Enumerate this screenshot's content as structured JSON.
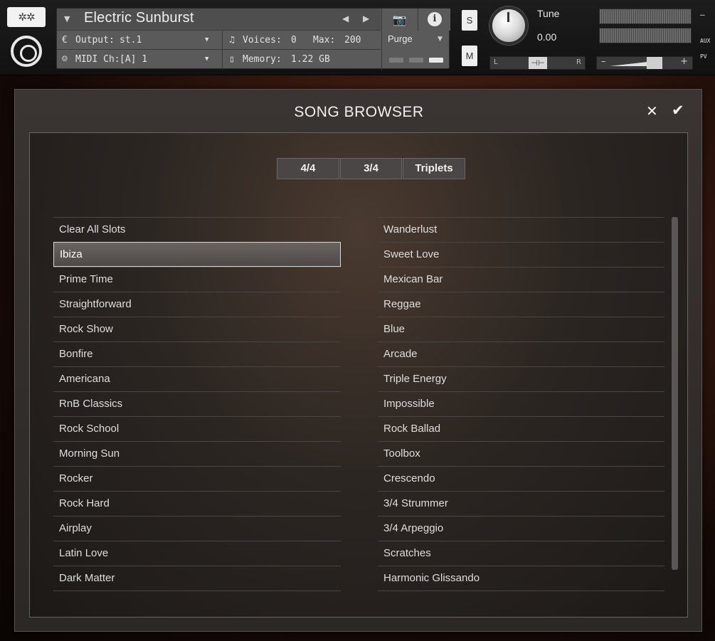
{
  "header": {
    "logo_icon": "snowflake-icon",
    "instrument_name": "Electric Sunburst",
    "output_label": "Output:",
    "output_value": "st.1",
    "voices_label": "Voices:",
    "voices_value": "0",
    "max_label": "Max:",
    "max_value": "200",
    "purge_label": "Purge",
    "midi_label": "MIDI Ch:",
    "midi_value": "[A] 1",
    "memory_label": "Memory:",
    "memory_value": "1.22 GB",
    "solo_label": "S",
    "mute_label": "M",
    "tune_label": "Tune",
    "tune_value": "0.00",
    "pan_left": "L",
    "pan_right": "R",
    "vol_minus": "–",
    "vol_plus": "+",
    "aux_label": "AUX",
    "pv_label": "PV",
    "aux_minus": "–"
  },
  "dialog": {
    "title": "SONG BROWSER",
    "tabs": [
      "4/4",
      "3/4",
      "Triplets"
    ],
    "left_list": [
      "Clear All Slots",
      "Ibiza",
      "Prime Time",
      "Straightforward",
      "Rock Show",
      "Bonfire",
      "Americana",
      "RnB Classics",
      "Rock School",
      "Morning Sun",
      "Rocker",
      "Rock Hard",
      "Airplay",
      "Latin Love",
      "Dark Matter"
    ],
    "right_list": [
      "Wanderlust",
      "Sweet Love",
      "Mexican Bar",
      "Reggae",
      "Blue",
      "Arcade",
      "Triple Energy",
      "Impossible",
      "Rock Ballad",
      "Toolbox",
      "Crescendo",
      "3/4 Strummer",
      "3/4 Arpeggio",
      "Scratches",
      "Harmonic Glissando"
    ],
    "selected": "Ibiza"
  }
}
